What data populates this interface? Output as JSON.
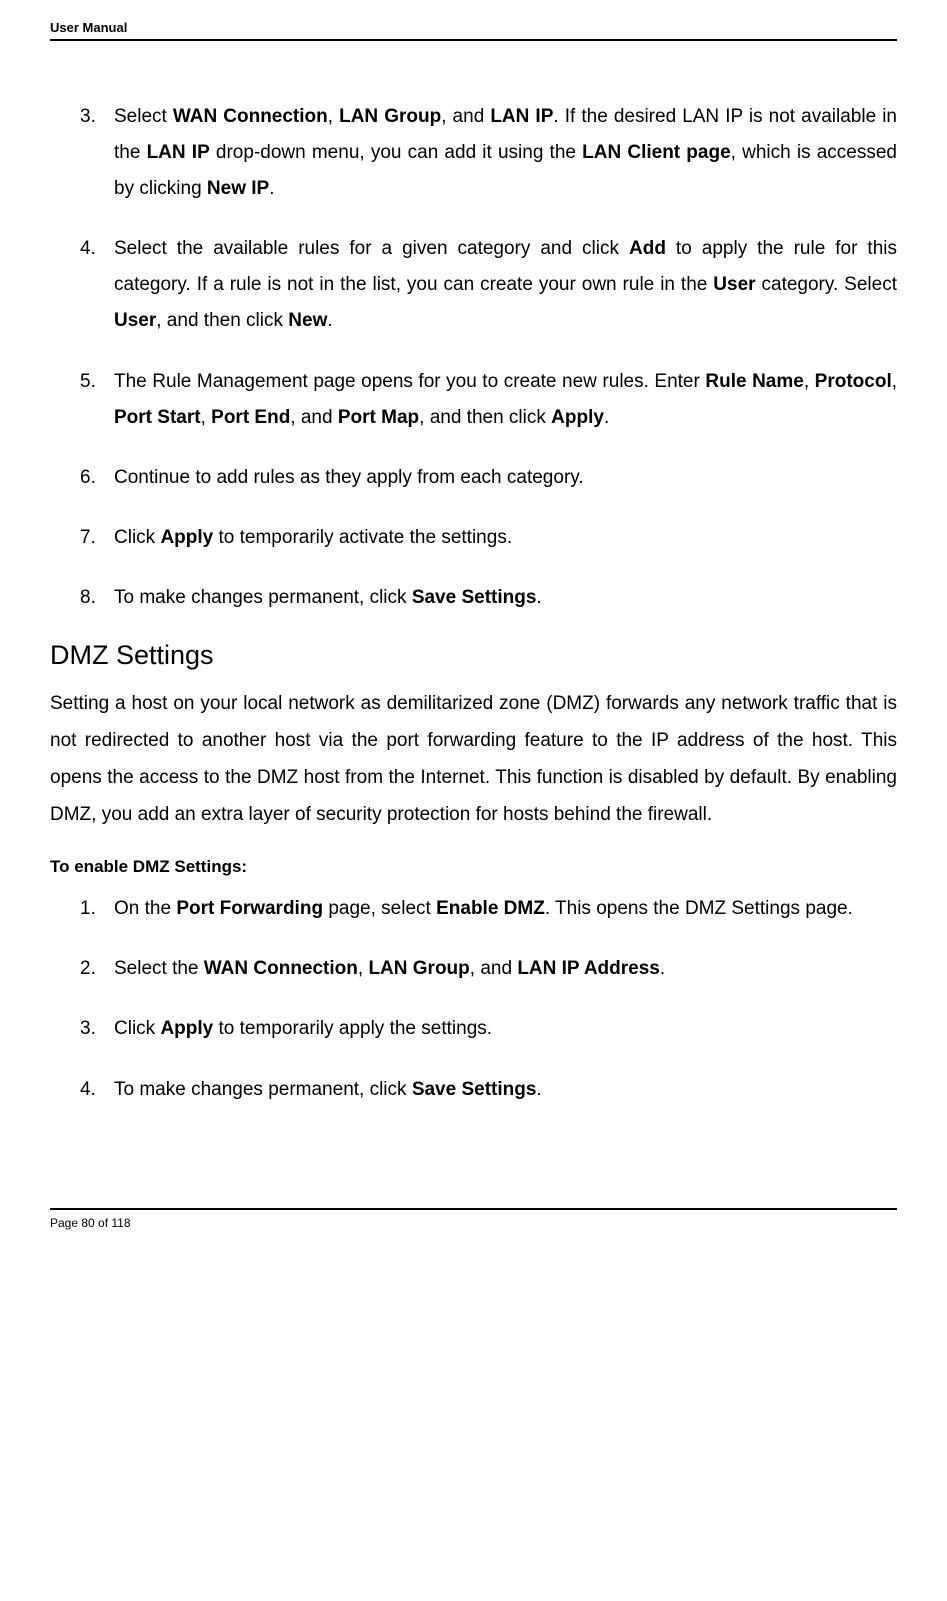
{
  "header": {
    "title": "User Manual"
  },
  "items": [
    {
      "number": "3.",
      "parts": [
        {
          "text": "Select ",
          "bold": false
        },
        {
          "text": "WAN Connection",
          "bold": true
        },
        {
          "text": ", ",
          "bold": false
        },
        {
          "text": "LAN Group",
          "bold": true
        },
        {
          "text": ", and ",
          "bold": false
        },
        {
          "text": "LAN IP",
          "bold": true
        },
        {
          "text": ". If the desired LAN IP is not available in the ",
          "bold": false
        },
        {
          "text": "LAN IP",
          "bold": true
        },
        {
          "text": " drop-down menu, you can add it using the ",
          "bold": false
        },
        {
          "text": "LAN Client page",
          "bold": true
        },
        {
          "text": ", which is accessed by clicking ",
          "bold": false
        },
        {
          "text": "New IP",
          "bold": true
        },
        {
          "text": ".",
          "bold": false
        }
      ]
    },
    {
      "number": "4.",
      "parts": [
        {
          "text": "Select the available rules for a given category and click ",
          "bold": false
        },
        {
          "text": "Add",
          "bold": true
        },
        {
          "text": " to apply the rule for this category. If a rule is not in the list, you can create your own rule in the ",
          "bold": false
        },
        {
          "text": "User",
          "bold": true
        },
        {
          "text": " category. Select ",
          "bold": false
        },
        {
          "text": "User",
          "bold": true
        },
        {
          "text": ", and then click ",
          "bold": false
        },
        {
          "text": "New",
          "bold": true
        },
        {
          "text": ".",
          "bold": false
        }
      ]
    },
    {
      "number": "5.",
      "parts": [
        {
          "text": "The Rule Management page opens for you to create new rules. Enter ",
          "bold": false
        },
        {
          "text": "Rule Name",
          "bold": true
        },
        {
          "text": ", ",
          "bold": false
        },
        {
          "text": "Protocol",
          "bold": true
        },
        {
          "text": ", ",
          "bold": false
        },
        {
          "text": "Port Start",
          "bold": true
        },
        {
          "text": ", ",
          "bold": false
        },
        {
          "text": "Port End",
          "bold": true
        },
        {
          "text": ", and ",
          "bold": false
        },
        {
          "text": "Port Map",
          "bold": true
        },
        {
          "text": ", and then click ",
          "bold": false
        },
        {
          "text": "Apply",
          "bold": true
        },
        {
          "text": ".",
          "bold": false
        }
      ]
    },
    {
      "number": "6.",
      "parts": [
        {
          "text": "Continue to add rules as they apply from each category.",
          "bold": false
        }
      ]
    },
    {
      "number": "7.",
      "parts": [
        {
          "text": "Click ",
          "bold": false
        },
        {
          "text": "Apply",
          "bold": true
        },
        {
          "text": " to temporarily activate the settings.",
          "bold": false
        }
      ]
    },
    {
      "number": "8.",
      "parts": [
        {
          "text": "To make changes permanent, click ",
          "bold": false
        },
        {
          "text": "Save Settings",
          "bold": true
        },
        {
          "text": ".",
          "bold": false
        }
      ]
    }
  ],
  "section": {
    "heading": "DMZ Settings",
    "paragraph": "Setting a host on your local network as demilitarized zone (DMZ) forwards any network traffic that is not redirected to another host via the port forwarding feature to the IP address of the host. This opens the access to the DMZ host from the Internet. This function is disabled by default. By enabling DMZ, you add an extra layer of security protection for hosts behind the firewall.",
    "subheading": "To enable DMZ Settings:",
    "items": [
      {
        "number": "1.",
        "parts": [
          {
            "text": "On the ",
            "bold": false
          },
          {
            "text": "Port Forwarding",
            "bold": true
          },
          {
            "text": " page, select ",
            "bold": false
          },
          {
            "text": "Enable DMZ",
            "bold": true
          },
          {
            "text": ". This opens the DMZ Settings page.",
            "bold": false
          }
        ]
      },
      {
        "number": "2.",
        "parts": [
          {
            "text": "Select the ",
            "bold": false
          },
          {
            "text": "WAN Connection",
            "bold": true
          },
          {
            "text": ", ",
            "bold": false
          },
          {
            "text": "LAN Group",
            "bold": true
          },
          {
            "text": ", and ",
            "bold": false
          },
          {
            "text": "LAN IP Address",
            "bold": true
          },
          {
            "text": ".",
            "bold": false
          }
        ]
      },
      {
        "number": "3.",
        "parts": [
          {
            "text": "Click ",
            "bold": false
          },
          {
            "text": "Apply",
            "bold": true
          },
          {
            "text": " to temporarily apply the settings.",
            "bold": false
          }
        ]
      },
      {
        "number": "4.",
        "parts": [
          {
            "text": "To make changes permanent, click ",
            "bold": false
          },
          {
            "text": "Save Settings",
            "bold": true
          },
          {
            "text": ".",
            "bold": false
          }
        ]
      }
    ]
  },
  "footer": {
    "text": "Page 80 of 118"
  }
}
